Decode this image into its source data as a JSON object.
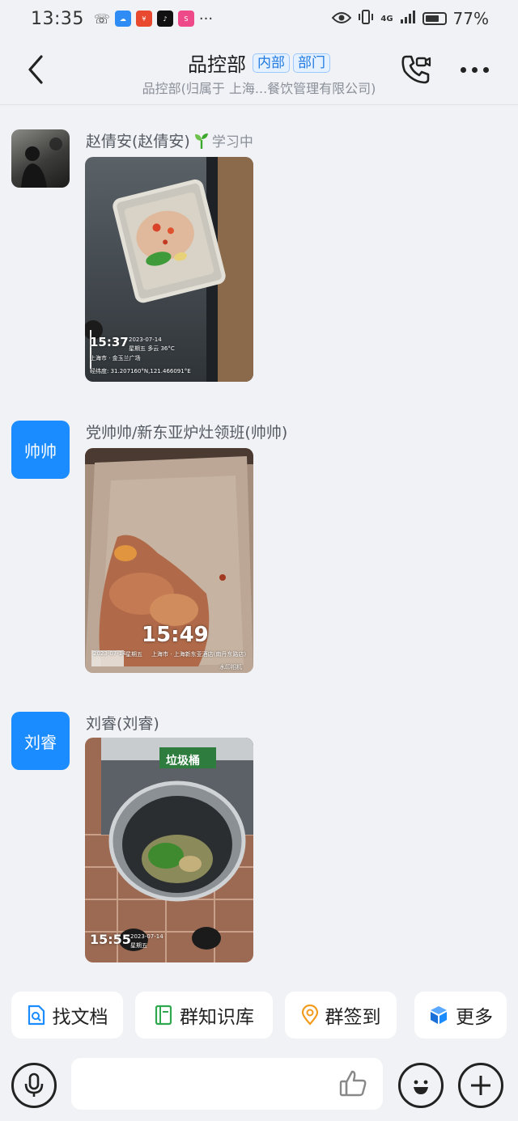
{
  "status_bar": {
    "time": "13:35",
    "network": "4G",
    "battery": "77%",
    "battery_level": 0.77
  },
  "header": {
    "title": "品控部",
    "tags": [
      "内部",
      "部门"
    ],
    "subtitle": "品控部(归属于 上海...餐饮管理有限公司)"
  },
  "messages": [
    {
      "sender": "赵倩安(赵倩安)",
      "status": "学习中",
      "avatar_text": "",
      "photo": {
        "time": "15:37",
        "date": "2023-07-14",
        "weekday_weather": "星期五 多云 36°C",
        "location": "上海市 · 金玉兰广场",
        "coords": "经纬度: 31.207160°N,121.466091°E"
      }
    },
    {
      "sender": "党帅帅/新东亚炉灶领班(帅帅)",
      "status": "",
      "avatar_text": "帅帅",
      "photo": {
        "time": "15:49",
        "date": "2023-07-14",
        "weekday": "星期五",
        "location": "上海市 · 上海新东亚酒店(南丹东路店)",
        "watermark": "水印相机"
      }
    },
    {
      "sender": "刘睿(刘睿)",
      "status": "",
      "avatar_text": "刘睿",
      "photo": {
        "time": "15:55",
        "date": "2023-07-14",
        "weekday": "星期五",
        "sign": "垃圾桶"
      }
    }
  ],
  "quick_actions": [
    {
      "label": "找文档",
      "icon": "doc-search-icon"
    },
    {
      "label": "群知识库",
      "icon": "knowledge-book-icon"
    },
    {
      "label": "群签到",
      "icon": "location-pin-icon"
    },
    {
      "label": "更多",
      "icon": "cubes-icon"
    }
  ],
  "input": {
    "placeholder": ""
  },
  "colors": {
    "accent": "#1a8cff",
    "background": "#f1f2f5"
  }
}
